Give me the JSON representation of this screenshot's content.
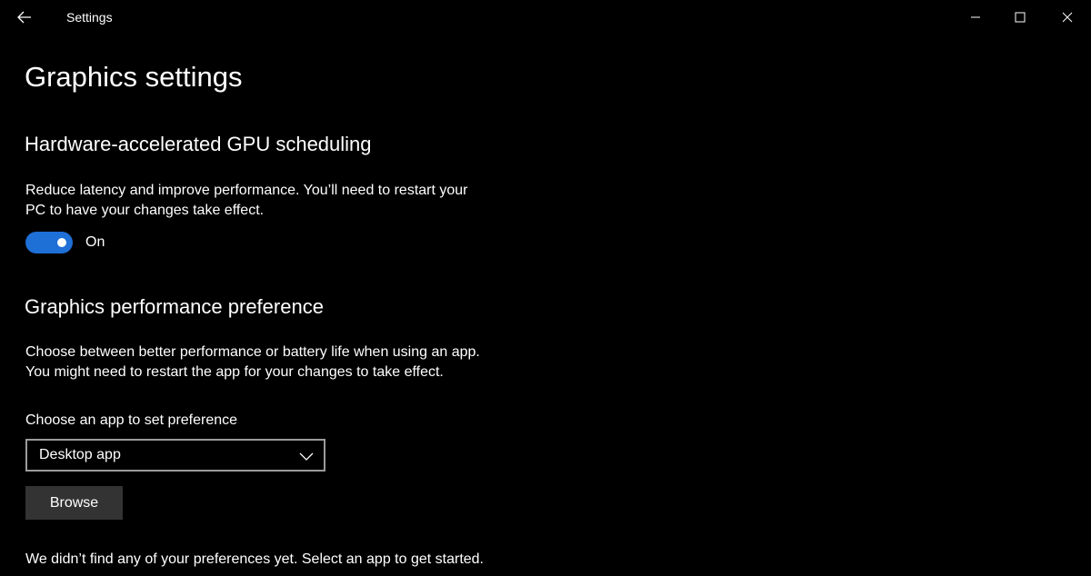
{
  "window": {
    "title": "Settings"
  },
  "page": {
    "title": "Graphics settings"
  },
  "gpu_scheduling": {
    "heading": "Hardware-accelerated GPU scheduling",
    "description_line1": "Reduce latency and improve performance. You’ll need to restart your",
    "description_line2": "PC to have your changes take effect.",
    "toggle_state": "On",
    "toggle_on": true
  },
  "performance_preference": {
    "heading": "Graphics performance preference",
    "description_line1": "Choose between better performance or battery life when using an app.",
    "description_line2": "You might need to restart the app for your changes to take effect.",
    "choose_label": "Choose an app to set preference",
    "select_value": "Desktop app",
    "browse_label": "Browse",
    "empty_message": "We didn’t find any of your preferences yet. Select an app to get started."
  },
  "icons": {
    "back": "back-arrow-icon",
    "minimize": "minimize-icon",
    "maximize": "maximize-icon",
    "close": "close-icon",
    "dropdown": "chevron-down-icon"
  },
  "colors": {
    "background": "#000000",
    "accent": "#1e6fd6",
    "button_bg": "#333333",
    "select_border": "#9b9b9b"
  }
}
